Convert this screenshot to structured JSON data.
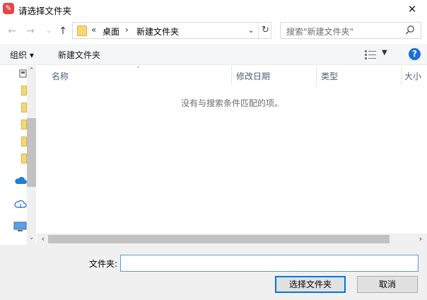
{
  "window": {
    "title": "请选择文件夹",
    "app_icon": "pencil-app-icon",
    "close_glyph": "✕"
  },
  "nav": {
    "back_glyph": "←",
    "forward_glyph": "→",
    "recent_glyph": "⌄",
    "up_glyph": "↑",
    "address_overflow": "«",
    "crumbs": [
      "桌面",
      "新建文件夹"
    ],
    "crumb_sep": "›",
    "dropdown_glyph": "⌄",
    "refresh_glyph": "↻",
    "search_placeholder": "搜索\"新建文件夹\""
  },
  "toolbar": {
    "organize_label": "组织 ▾",
    "new_folder_label": "新建文件夹",
    "view_caret": "▼",
    "help_label": "?"
  },
  "columns": {
    "name": "名称",
    "modified": "修改日期",
    "type": "类型",
    "size": "大小",
    "sort_glyph": "⌄"
  },
  "content": {
    "empty_message": "没有与搜索条件匹配的项。"
  },
  "scroll": {
    "up_glyph": "⌃",
    "down_glyph": "⌄",
    "left_glyph": "‹",
    "right_glyph": "›"
  },
  "footer": {
    "folder_label": "文件夹:",
    "folder_value": "",
    "select_button": "选择文件夹",
    "cancel_button": "取消"
  },
  "colors": {
    "accent": "#0078d7",
    "folder": "#f6d774",
    "help": "#1e6fd4",
    "app_icon": "#e5454a"
  }
}
